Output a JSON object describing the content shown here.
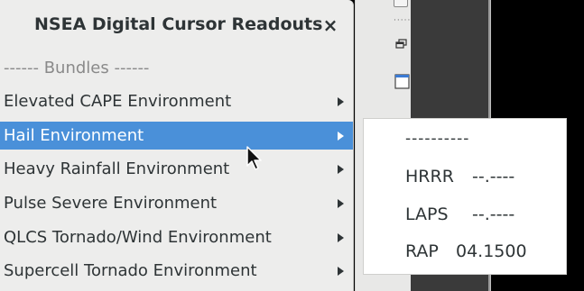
{
  "menu": {
    "title": "NSEA Digital Cursor Readouts",
    "close_label": "×",
    "header_label": "------ Bundles ------",
    "items": [
      {
        "label": "Elevated CAPE Environment"
      },
      {
        "label": "Hail Environment"
      },
      {
        "label": "Heavy Rainfall Environment"
      },
      {
        "label": "Pulse Severe Environment"
      },
      {
        "label": "QLCS Tornado/Wind Environment"
      },
      {
        "label": "Supercell Tornado Environment"
      }
    ],
    "selected_index": 1
  },
  "submenu": {
    "separator": "----------",
    "rows": [
      {
        "model": "HRRR",
        "value": "--.----"
      },
      {
        "model": "LAPS",
        "value": "--.----"
      },
      {
        "model": "RAP",
        "value": "04.1500"
      }
    ]
  },
  "toolbar": {
    "dots": "·····"
  },
  "colors": {
    "menu_bg": "#ededec",
    "selected_bg": "#4a90d9",
    "text": "#2e3436",
    "header_text": "#8a8a8a"
  },
  "icons": [
    "close-icon",
    "chevron-right-icon",
    "restore-window-icon",
    "window-icon",
    "mouse-cursor-icon"
  ]
}
